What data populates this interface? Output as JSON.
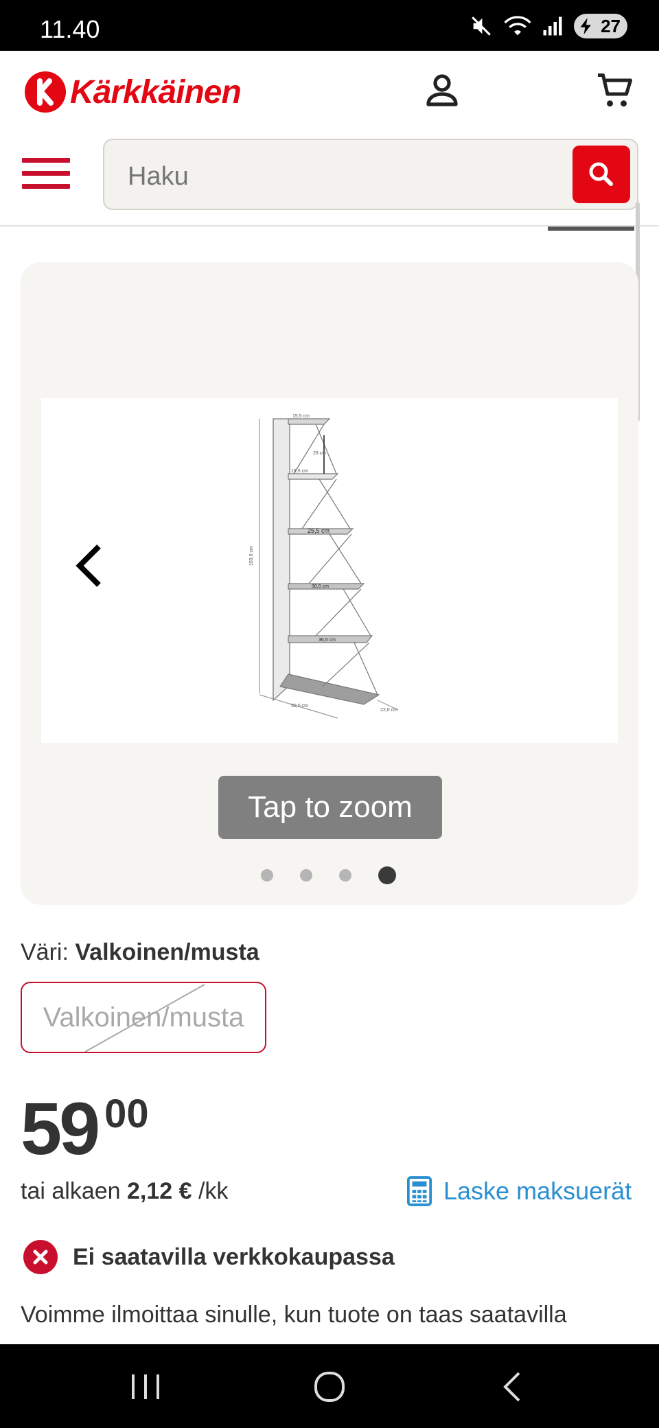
{
  "status_bar": {
    "time": "11.40",
    "battery": "27"
  },
  "header": {
    "logo_text": "Kärkkäinen",
    "search_placeholder": "Haku",
    "colors": {
      "brand_red": "#e30613"
    }
  },
  "gallery": {
    "zoom_label": "Tap to zoom",
    "dot_count": 4,
    "active_dot_index": 3,
    "dimension_labels": [
      "15,5 cm",
      "28 cm",
      "19,5 cm",
      "25,5 cm",
      "150,0 cm",
      "30,5 cm",
      "36,5 cm",
      "50,0 cm",
      "22,0 cm"
    ]
  },
  "variant": {
    "label": "Väri:",
    "value": "Valkoinen/musta",
    "option_label": "Valkoinen/musta",
    "option_unavailable": true
  },
  "price": {
    "main": "59",
    "cents": "00",
    "installment_prefix": "tai alkaen",
    "installment_amount": "2,12 €",
    "installment_suffix": "/kk",
    "calculator_label": "Laske maksuerät",
    "link_color": "#2a8fd1"
  },
  "availability": {
    "status": "Ei saatavilla verkkokaupassa",
    "notify_text": "Voimme ilmoittaa sinulle, kun tuote on taas saatavilla"
  }
}
